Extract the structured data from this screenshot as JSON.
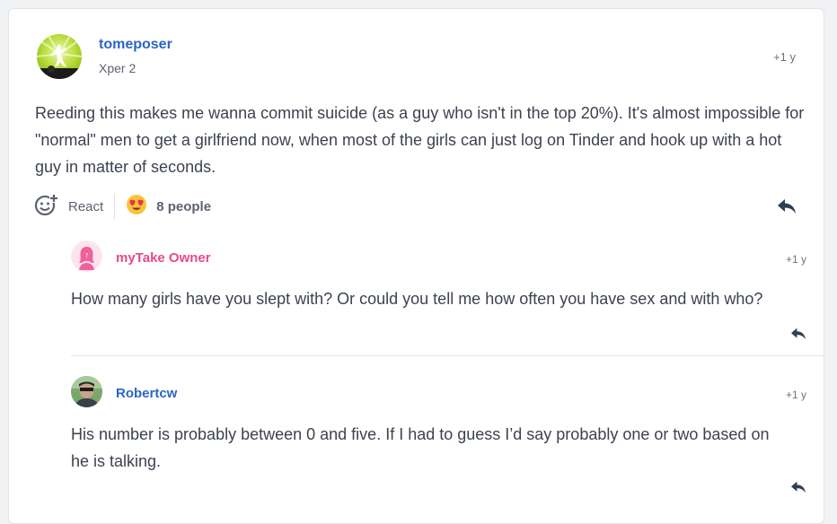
{
  "post": {
    "username": "tomeposer",
    "level": "Xper 2",
    "time": "+1 y",
    "text": "Reeding this makes me wanna commit suicide (as a guy who isn't in the top 20%). It's almost impossible for \"normal\" men to get a girlfriend now, when most of the girls can just log on Tinder and hook up with a hot guy in matter of seconds.",
    "react_label": "React",
    "reactions_label": "8 people",
    "reaction_icon": "heart-eyes-emoji-icon"
  },
  "replies": [
    {
      "username": "myTake Owner",
      "time": "+1 y",
      "text": "How many girls have you slept with? Or could you tell me how often you have sex and with who?",
      "name_color": "#e84a8a"
    },
    {
      "username": "Robertcw",
      "time": "+1 y",
      "text": "His number is probably between 0 and five. If I had to guess I’d say probably one or two based on he is talking.",
      "name_color": "#2b65c4"
    }
  ],
  "colors": {
    "link": "#2b65c4",
    "pink": "#e84a8a",
    "text": "#3c4250",
    "muted": "#5b6270"
  }
}
